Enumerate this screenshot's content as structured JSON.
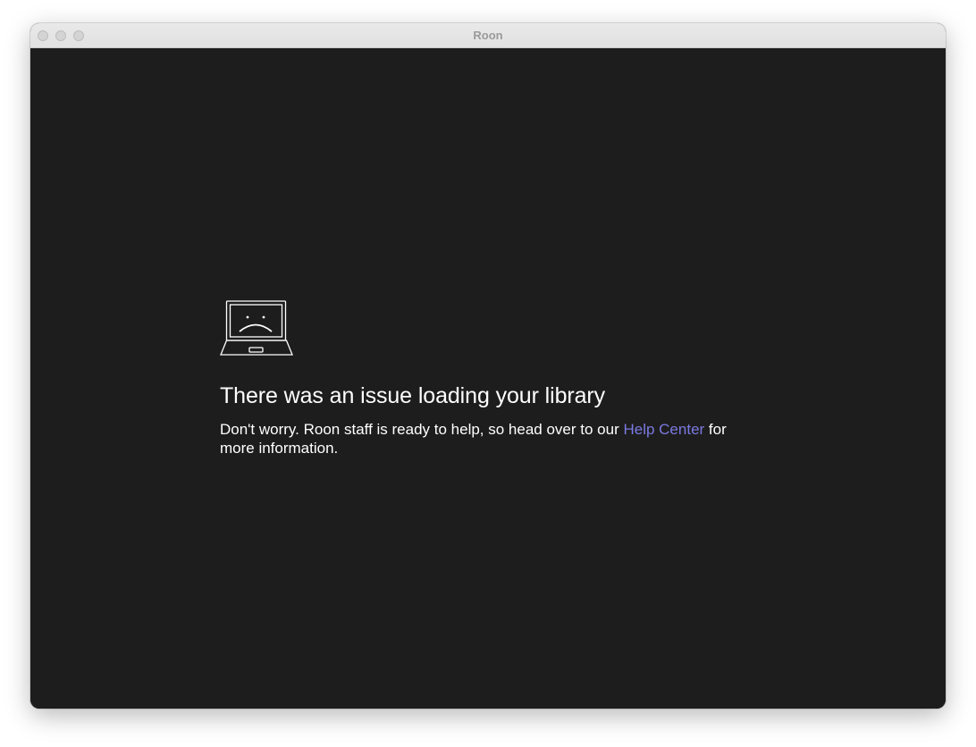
{
  "window": {
    "title": "Roon"
  },
  "error": {
    "icon": "sad-laptop-icon",
    "title": "There was an issue loading your library",
    "message_before": "Don't worry. Roon staff is ready to help, so head over to our ",
    "link_label": "Help Center",
    "message_after": " for more information."
  },
  "colors": {
    "background": "#1d1d1d",
    "text": "#ffffff",
    "link": "#7b79e0"
  }
}
